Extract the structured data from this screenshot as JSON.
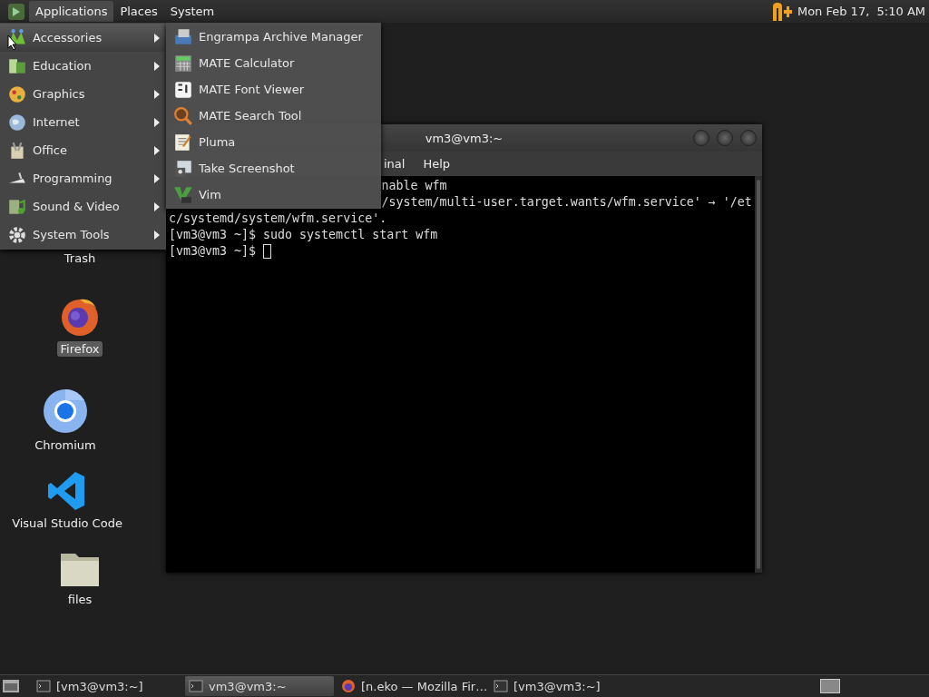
{
  "top_panel": {
    "menus": [
      {
        "label": "Applications",
        "selected": true
      },
      {
        "label": "Places",
        "selected": false
      },
      {
        "label": "System",
        "selected": false
      }
    ],
    "clock": "Mon Feb 17,  5:10 AM"
  },
  "applications_menu": [
    {
      "label": "Accessories",
      "selected": true
    },
    {
      "label": "Education",
      "selected": false
    },
    {
      "label": "Graphics",
      "selected": false
    },
    {
      "label": "Internet",
      "selected": false
    },
    {
      "label": "Office",
      "selected": false
    },
    {
      "label": "Programming",
      "selected": false
    },
    {
      "label": "Sound & Video",
      "selected": false
    },
    {
      "label": "System Tools",
      "selected": false
    }
  ],
  "submenu": [
    "Engrampa Archive Manager",
    "MATE Calculator",
    "MATE Font Viewer",
    "MATE Search Tool",
    "Pluma",
    "Take Screenshot",
    "Vim"
  ],
  "desktop_icons": [
    {
      "label": "Trash",
      "selected": false
    },
    {
      "label": "Firefox",
      "selected": true
    },
    {
      "label": "Chromium",
      "selected": false
    },
    {
      "label": "Visual Studio Code",
      "selected": false
    },
    {
      "label": "files",
      "selected": false
    }
  ],
  "terminal": {
    "title": "vm3@vm3:~",
    "menubar": [
      "inal",
      "Help"
    ],
    "lines": [
      {
        "kind": "cut",
        "text": "nable wfm"
      },
      {
        "kind": "cut",
        "text": "/system/multi-user.target.wants/wfm.service' → '/et"
      },
      {
        "kind": "full",
        "text": "c/systemd/system/wfm.service'."
      },
      {
        "kind": "full",
        "text": "[vm3@vm3 ~]$ sudo systemctl start wfm"
      },
      {
        "kind": "input",
        "text": "[vm3@vm3 ~]$ "
      }
    ]
  },
  "taskbar": [
    {
      "label": "[vm3@vm3:~]",
      "selected": false
    },
    {
      "label": "vm3@vm3:~",
      "selected": true
    },
    {
      "label": "[n.eko — Mozilla Fir…",
      "selected": false
    },
    {
      "label": "[vm3@vm3:~]",
      "selected": false
    }
  ]
}
